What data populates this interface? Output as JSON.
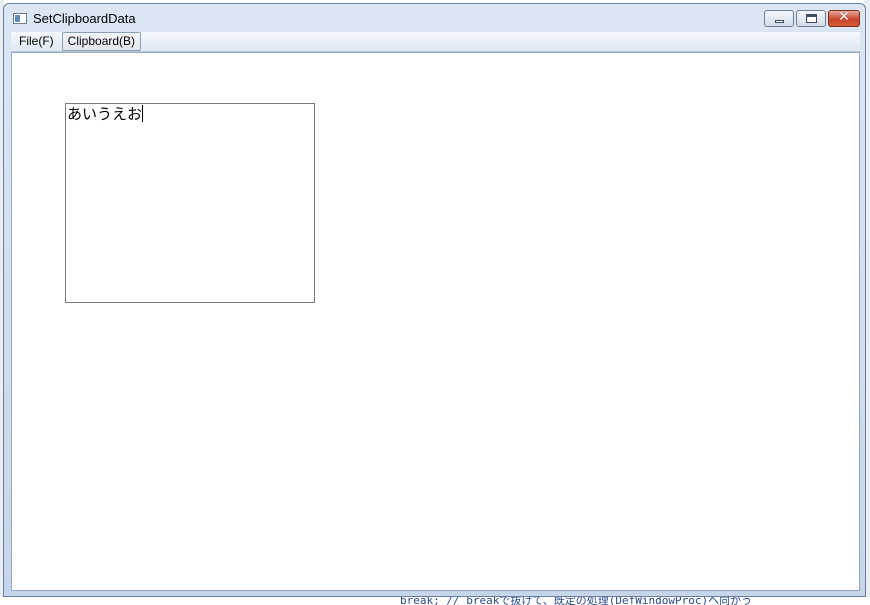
{
  "window": {
    "title": "SetClipboardData",
    "icon": "app-window-icon",
    "buttons": {
      "minimize": "minimize-icon",
      "maximize": "maximize-icon",
      "close": "close-icon"
    }
  },
  "menubar": {
    "items": [
      {
        "label": "File(F)"
      },
      {
        "label": "Clipboard(B)"
      }
    ]
  },
  "editor": {
    "text": "あいうえお"
  },
  "background": {
    "code_line": "break;  // breakで抜けて、既定の処理(DefWindowProc)へ向かう"
  },
  "colors": {
    "frame": "#c6d6ea",
    "close_button": "#c8452c",
    "menu_bar": "#eaf0f8"
  }
}
